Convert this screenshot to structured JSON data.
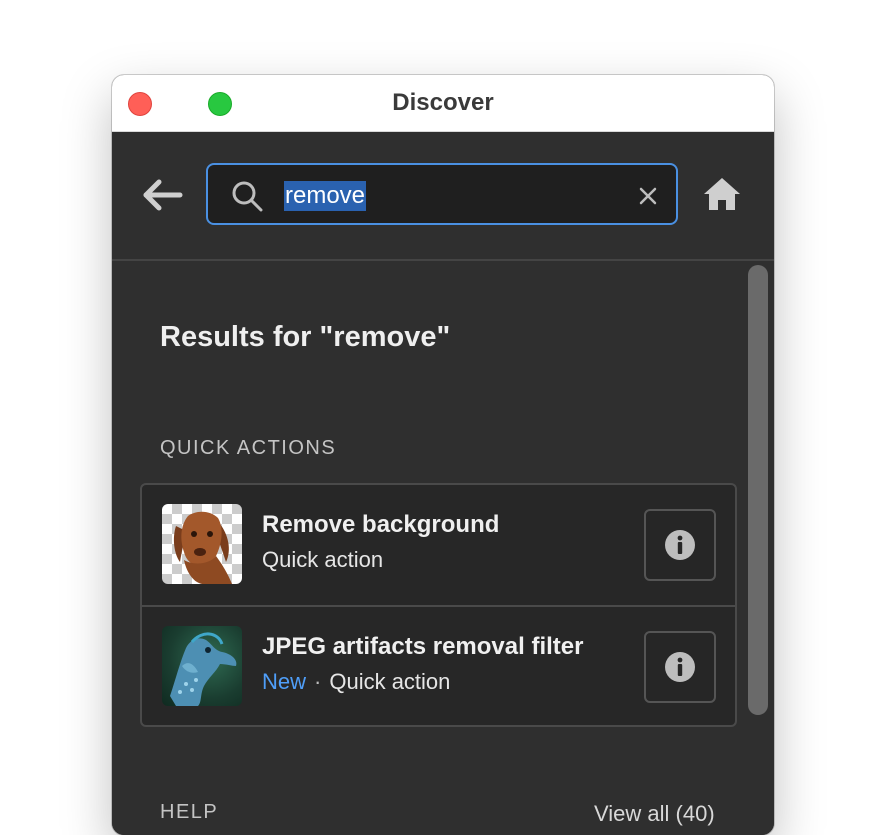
{
  "window": {
    "title": "Discover"
  },
  "toolbar": {
    "back_icon": "back-arrow-icon",
    "home_icon": "home-icon"
  },
  "search": {
    "value": "remove",
    "icon": "search-icon",
    "clear_icon": "close-icon",
    "focus_color": "#4a90e2"
  },
  "results": {
    "title": "Results for \"remove\"",
    "quick_actions_label": "QUICK ACTIONS",
    "items": [
      {
        "title": "Remove background",
        "badge": "",
        "subtitle": "Quick action",
        "thumbnail": "dog-portrait-thumbnail"
      },
      {
        "title": "JPEG artifacts removal filter",
        "badge": "New",
        "separator": "·",
        "subtitle": "Quick action",
        "thumbnail": "seahorse-thumbnail"
      }
    ]
  },
  "help": {
    "label": "HELP",
    "view_all": "View all (40)"
  },
  "colors": {
    "panel_bg": "#2f2f2f",
    "accent_blue": "#4f9ef8",
    "close_button": "#ff5f57",
    "zoom_button": "#28c840"
  }
}
